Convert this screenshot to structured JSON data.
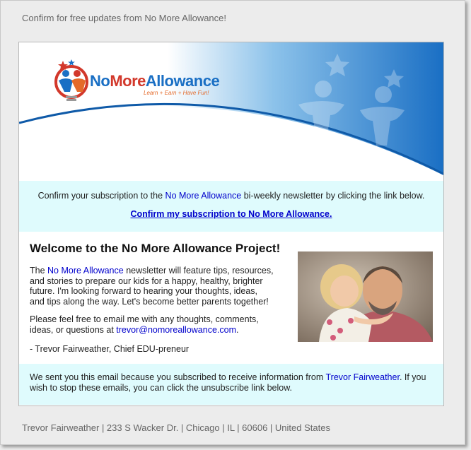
{
  "preheader": "Confirm for free updates from No More Allowance!",
  "logo": {
    "text_no": "No",
    "text_more": "More",
    "text_allowance": "Allowance",
    "tagline": "Learn + Earn + Have Fun!"
  },
  "confirm": {
    "text_before": "Confirm your subscription to the ",
    "link_name": "No More Allowance",
    "text_after": " bi-weekly newsletter by clicking the link below.",
    "link_label": "Confirm my subscription to No More Allowance."
  },
  "welcome": {
    "title": "Welcome to the No More Allowance Project!",
    "p1_before": "The ",
    "p1_link": "No More Allowance",
    "p1_after": " newsletter will feature tips, resources, and stories to prepare our kids for a happy, healthy, brighter future. I'm looking forward to hearing your thoughts, ideas, and tips along the way. Let's become better parents together!",
    "p2_before": "Please feel free to email me with any thoughts, comments, ideas, or questions at ",
    "p2_email": "trevor@nomoreallowance.com",
    "p2_after": ".",
    "signature": "- Trevor Fairweather, Chief EDU-preneur"
  },
  "footer": {
    "text_before": "We sent you this email because you subscribed to receive information from ",
    "link_name": "Trevor Fairweather",
    "text_after": ". If you wish to stop these emails, you can click the unsubscribe link below."
  },
  "address": "Trevor Fairweather | 233 S Wacker Dr. | Chicago | IL | 60606 | United States",
  "colors": {
    "accent_blue": "#1a6fc4",
    "light_cyan": "#dffbfd",
    "link": "#0000cc",
    "logo_red": "#d2382b"
  }
}
